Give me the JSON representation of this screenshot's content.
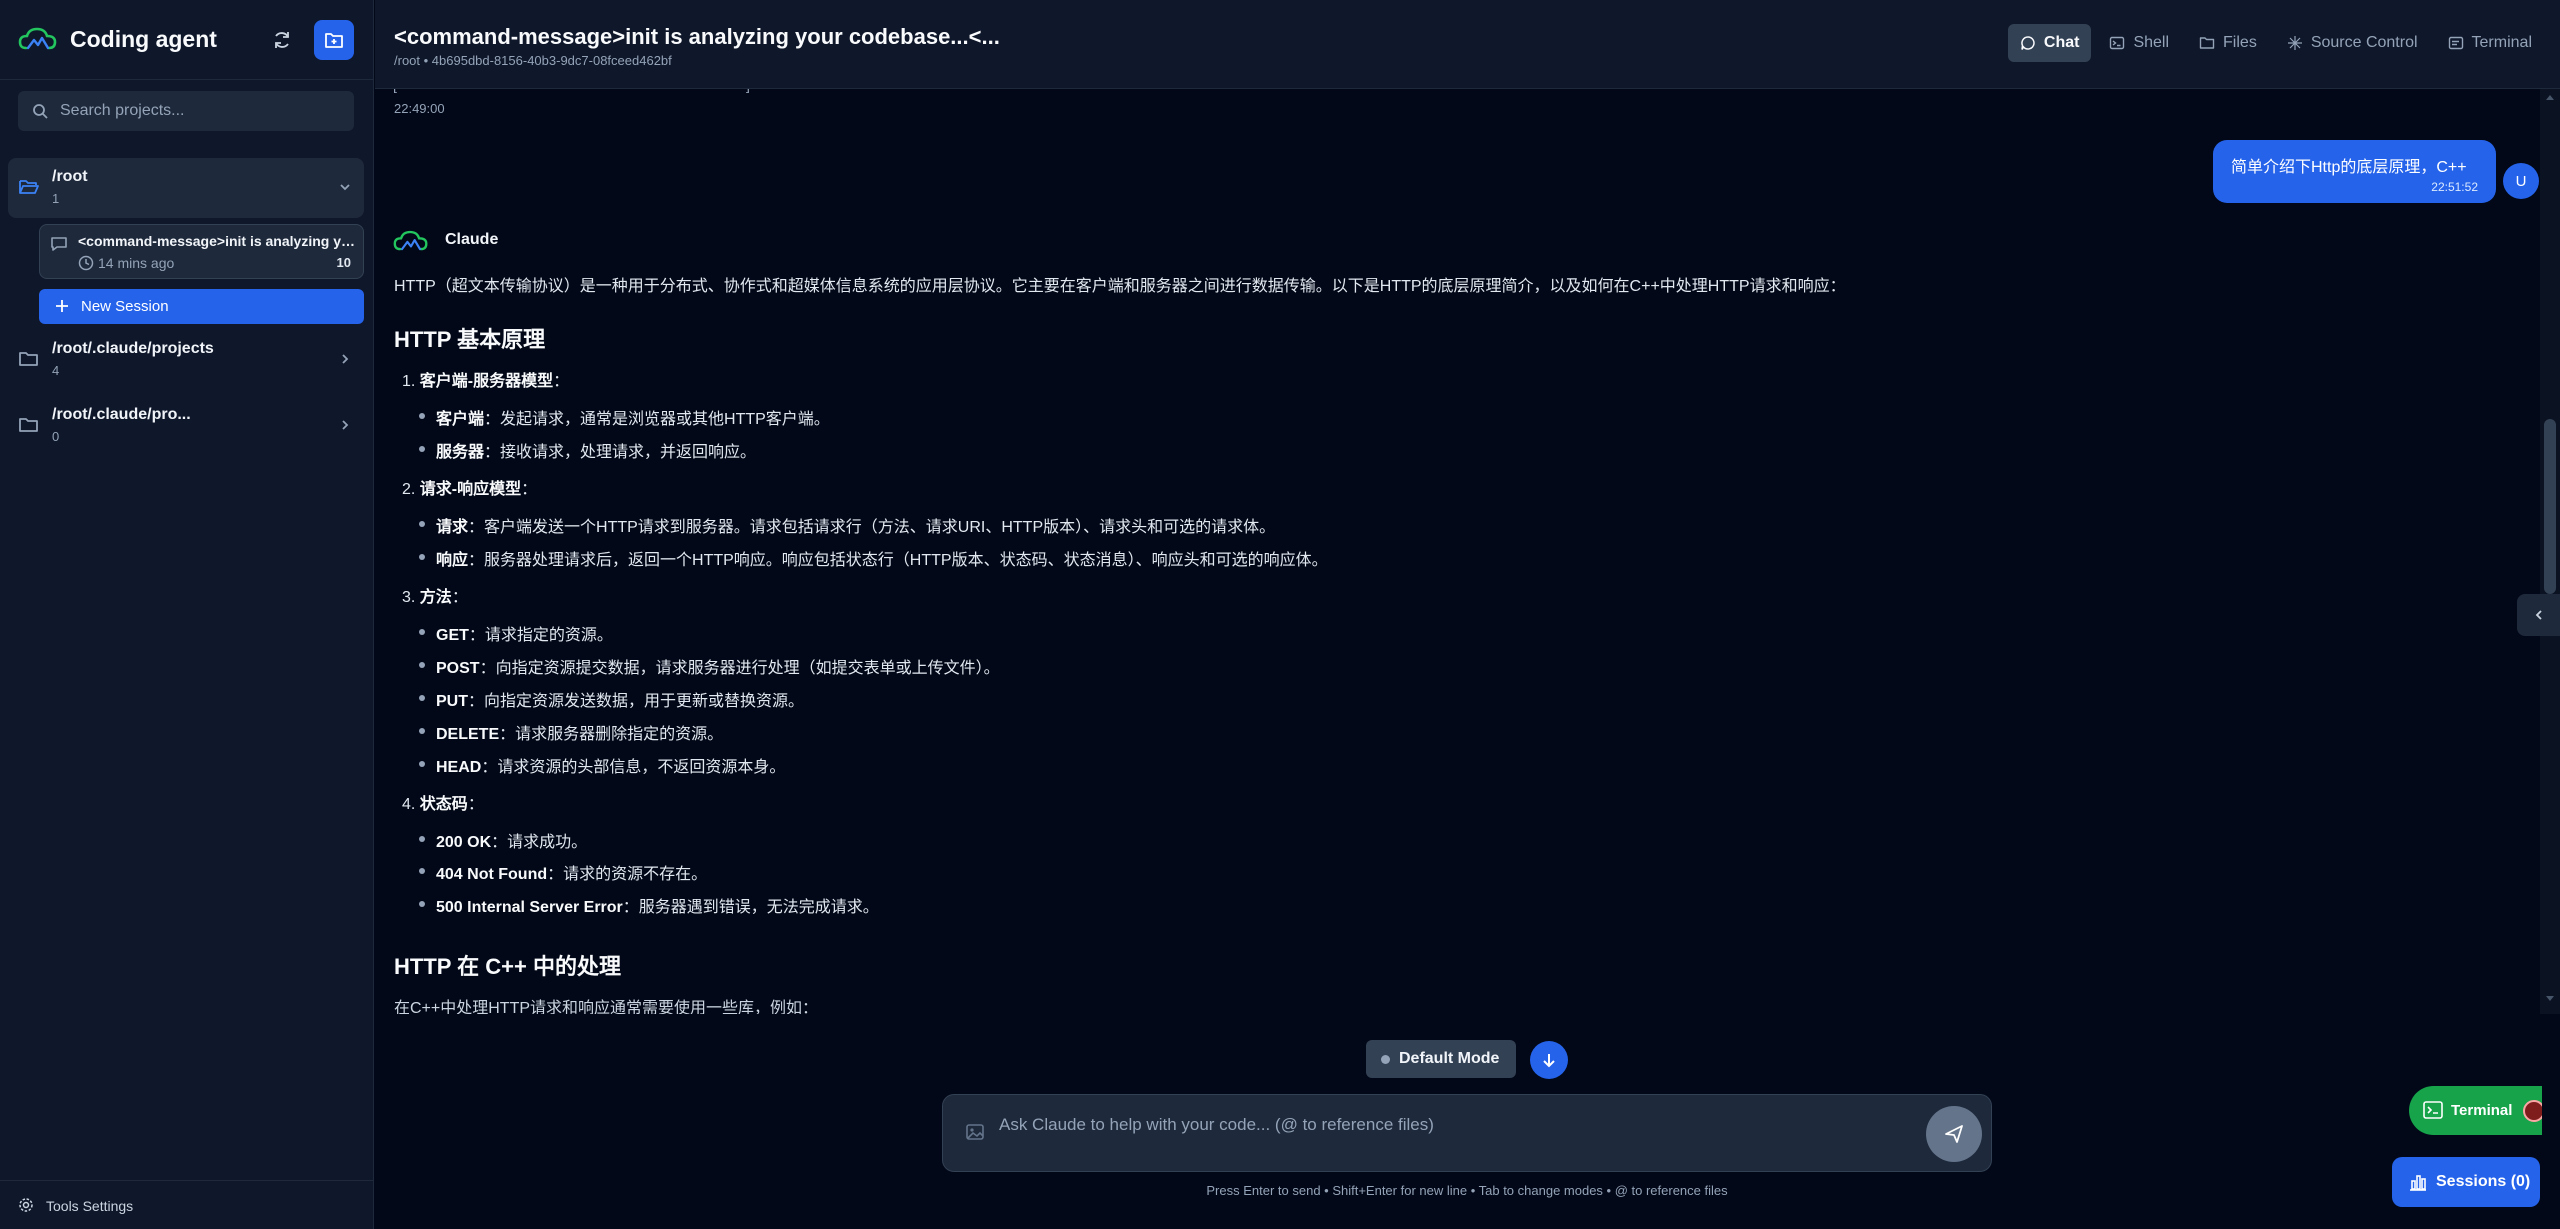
{
  "sidebar": {
    "brand": "Coding agent",
    "search_placeholder": "Search projects...",
    "projects": [
      {
        "name": "/root",
        "count": "1",
        "expanded": true
      },
      {
        "name": "/root/.claude/projects",
        "count": "4",
        "expanded": false
      },
      {
        "name": "/root/.claude/pro...",
        "count": "0",
        "expanded": false
      }
    ],
    "session": {
      "title": "<command-message>init is analyzing yo...",
      "time": "14 mins ago",
      "count": "10"
    },
    "new_session_label": "New Session",
    "tools_settings_label": "Tools Settings"
  },
  "header": {
    "title": "<command-message>init is analyzing your codebase...<...",
    "subtitle": "/root • 4b695dbd-8156-40b3-9dc7-08fceed462bf",
    "tabs": [
      {
        "label": "Chat",
        "active": true
      },
      {
        "label": "Shell",
        "active": false
      },
      {
        "label": "Files",
        "active": false
      },
      {
        "label": "Source Control",
        "active": false
      },
      {
        "label": "Terminal",
        "active": false
      }
    ]
  },
  "chat": {
    "prev_time": "22:49:00",
    "user_message": {
      "text": "简单介绍下Http的底层原理，C++",
      "time": "22:51:52",
      "avatar": "U"
    },
    "assistant_name": "Claude",
    "intro": "HTTP（超文本传输协议）是一种用于分布式、协作式和超媒体信息系统的应用层协议。它主要在客户端和服务器之间进行数据传输。以下是HTTP的底层原理简介，以及如何在C++中处理HTTP请求和响应：",
    "heading1": "HTTP 基本原理",
    "sections": [
      {
        "index": "1.",
        "title": "客户端-服务器模型",
        "items": [
          {
            "term": "客户端",
            "desc": "：发起请求，通常是浏览器或其他HTTP客户端。"
          },
          {
            "term": "服务器",
            "desc": "：接收请求，处理请求，并返回响应。"
          }
        ]
      },
      {
        "index": "2.",
        "title": "请求-响应模型",
        "items": [
          {
            "term": "请求",
            "desc": "：客户端发送一个HTTP请求到服务器。请求包括请求行（方法、请求URI、HTTP版本）、请求头和可选的请求体。"
          },
          {
            "term": "响应",
            "desc": "：服务器处理请求后，返回一个HTTP响应。响应包括状态行（HTTP版本、状态码、状态消息）、响应头和可选的响应体。"
          }
        ]
      },
      {
        "index": "3.",
        "title": "方法",
        "items": [
          {
            "term": "GET",
            "desc": "：请求指定的资源。"
          },
          {
            "term": "POST",
            "desc": "：向指定资源提交数据，请求服务器进行处理（如提交表单或上传文件）。"
          },
          {
            "term": "PUT",
            "desc": "：向指定资源发送数据，用于更新或替换资源。"
          },
          {
            "term": "DELETE",
            "desc": "：请求服务器删除指定的资源。"
          },
          {
            "term": "HEAD",
            "desc": "：请求资源的头部信息，不返回资源本身。"
          }
        ]
      },
      {
        "index": "4.",
        "title": "状态码",
        "items": [
          {
            "term": "200 OK",
            "desc": "：请求成功。"
          },
          {
            "term": "404 Not Found",
            "desc": "：请求的资源不存在。"
          },
          {
            "term": "500 Internal Server Error",
            "desc": "：服务器遇到错误，无法完成请求。"
          }
        ]
      }
    ],
    "heading2": "HTTP 在 C++ 中的处理",
    "cut_line": "在C++中处理HTTP请求和响应通常需要使用一些库，例如："
  },
  "composer": {
    "mode_label": "Default Mode",
    "placeholder": "Ask Claude to help with your code... (@ to reference files)",
    "hint": "Press Enter to send • Shift+Enter for new line • Tab to change modes • @ to reference files"
  },
  "floating": {
    "terminal_label": "Terminal",
    "sessions_label": "Sessions (0)"
  },
  "colors": {
    "accent": "#2563eb",
    "background": "#020817",
    "sidebar": "#0f172a",
    "terminal_green": "#16a34a"
  }
}
